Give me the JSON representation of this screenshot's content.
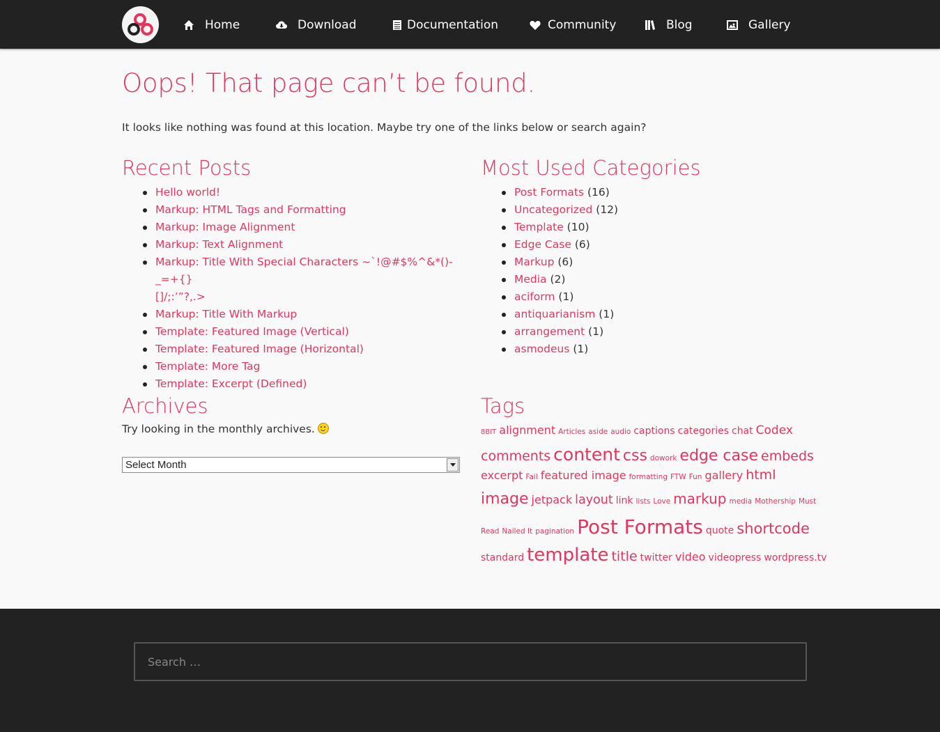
{
  "nav": {
    "items": [
      {
        "label": "Home",
        "icon": "home-icon"
      },
      {
        "label": "Download",
        "icon": "cloud-download-icon"
      },
      {
        "label": "Documentation",
        "icon": "document-icon"
      },
      {
        "label": "Community",
        "icon": "heart-icon"
      },
      {
        "label": "Blog",
        "icon": "book-icon"
      },
      {
        "label": "Gallery",
        "icon": "image-icon"
      }
    ]
  },
  "colors": {
    "accent": "#e2365e",
    "dark": "#222222",
    "background": "#f9f9f9"
  },
  "page": {
    "title": "Oops! That page can’t be found.",
    "intro": "It looks like nothing was found at this location. Maybe try one of the links below or search again?"
  },
  "recent_posts": {
    "title": "Recent Posts",
    "items": [
      "Hello world!",
      "Markup: HTML Tags and Formatting",
      "Markup: Image Alignment",
      "Markup: Text Alignment",
      "Markup: Title With Special Characters ~`!@#$%^&*()-_=+{}",
      "[]/;:’”?,.>",
      "Markup: Title With Markup",
      "Template: Featured Image (Vertical)",
      "Template: Featured Image (Horizontal)",
      "Template: More Tag",
      "Template: Excerpt (Defined)"
    ]
  },
  "categories": {
    "title": "Most Used Categories",
    "items": [
      {
        "name": "Post Formats",
        "count": "(16)"
      },
      {
        "name": "Uncategorized",
        "count": "(12)"
      },
      {
        "name": "Template",
        "count": "(10)"
      },
      {
        "name": "Edge Case",
        "count": "(6)"
      },
      {
        "name": "Markup",
        "count": "(6)"
      },
      {
        "name": "Media",
        "count": "(2)"
      },
      {
        "name": "aciform",
        "count": "(1)"
      },
      {
        "name": "antiquarianism",
        "count": "(1)"
      },
      {
        "name": "arrangement",
        "count": "(1)"
      },
      {
        "name": "asmodeus",
        "count": "(1)"
      }
    ]
  },
  "archives": {
    "title": "Archives",
    "text": "Try looking in the monthly archives.",
    "select_value": "Select Month"
  },
  "tags": {
    "title": "Tags",
    "lines": [
      [
        "8BIT",
        "alignment",
        "Articles",
        "aside",
        "audio",
        "captions",
        "categories",
        "chat",
        "Codex"
      ],
      [
        "comments",
        "content",
        "css",
        "dowork",
        "edge case",
        "embeds"
      ],
      [
        "excerpt",
        "Fail",
        "featured image",
        "formatting",
        "FTW",
        "Fun",
        "gallery",
        "html"
      ],
      [
        "image",
        "jetpack",
        "layout",
        "link",
        "lists",
        "Love",
        "markup",
        "media",
        "Mothership",
        "Must"
      ],
      [
        "Read",
        "Nailed It",
        "pagination",
        "Post Formats",
        "quote",
        "shortcode"
      ],
      [
        "standard",
        "template",
        "title",
        "twitter",
        "video",
        "videopress",
        "wordpress.tv"
      ]
    ]
  },
  "footer": {
    "search_placeholder": "Search …"
  }
}
